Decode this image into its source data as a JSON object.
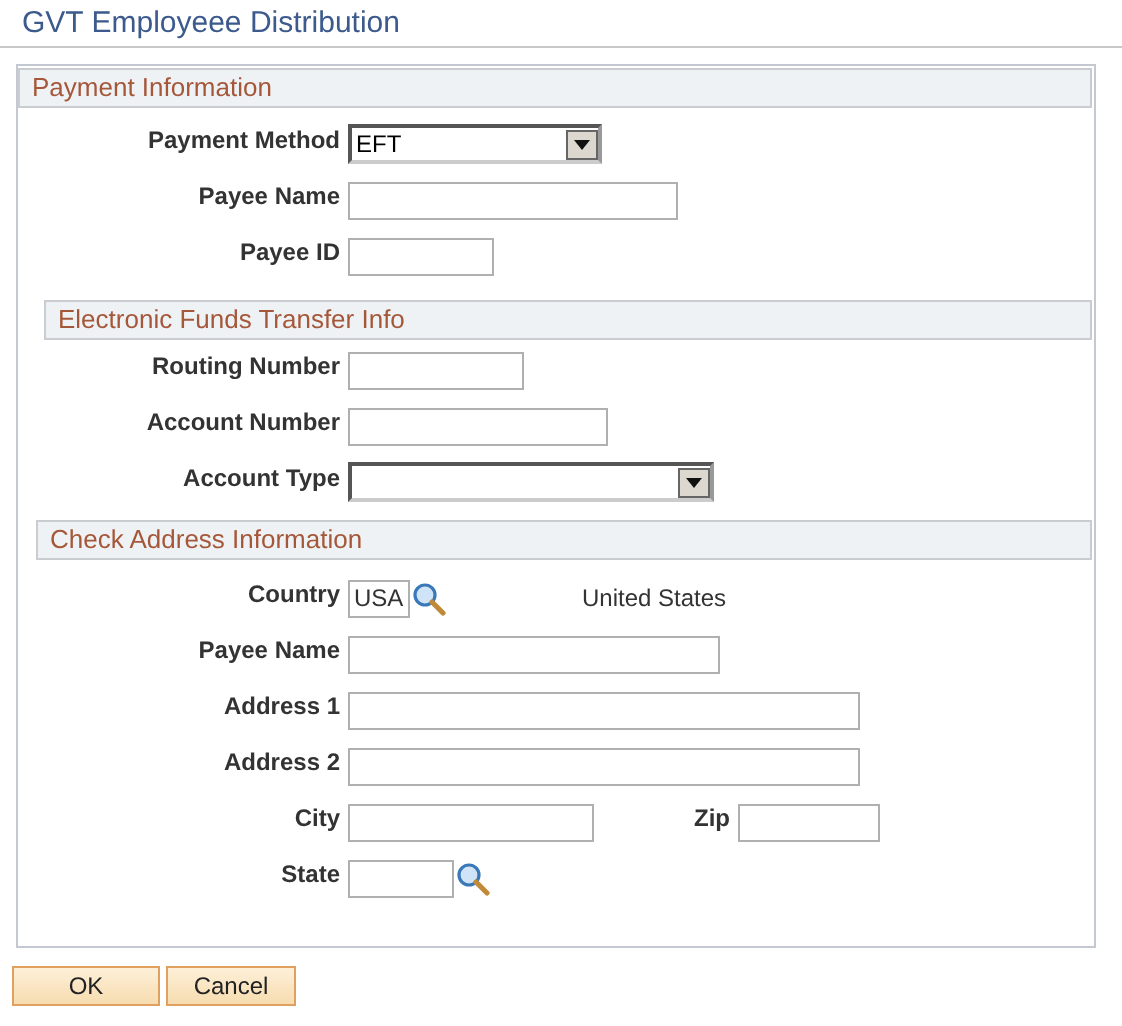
{
  "page_title": "GVT Employeee Distribution",
  "sections": [
    {
      "title": "Payment Information",
      "rows": [
        {
          "fields": [
            {
              "label": "Payment Method",
              "kind": "select",
              "value": "EFT"
            }
          ]
        },
        {
          "fields": [
            {
              "label": "Payee Name",
              "kind": "text"
            }
          ]
        },
        {
          "fields": [
            {
              "label": "Payee ID",
              "kind": "text"
            }
          ]
        }
      ]
    },
    {
      "title": "Electronic Funds Transfer Info",
      "rows": [
        {
          "fields": [
            {
              "label": "Routing Number",
              "kind": "text"
            }
          ]
        },
        {
          "fields": [
            {
              "label": "Account Number",
              "kind": "text"
            }
          ]
        },
        {
          "fields": [
            {
              "label": "Account Type",
              "kind": "select"
            }
          ]
        }
      ]
    },
    {
      "title": "Check Address Information",
      "rows": [
        {
          "fields": [
            {
              "label": "Country",
              "kind": "lookup",
              "value": "USA",
              "description": "United States"
            }
          ]
        },
        {
          "fields": [
            {
              "label": "Payee Name",
              "kind": "text"
            }
          ]
        },
        {
          "fields": [
            {
              "label": "Address 1",
              "kind": "text"
            }
          ]
        },
        {
          "fields": [
            {
              "label": "Address 2",
              "kind": "text"
            }
          ]
        },
        {
          "fields": [
            {
              "label": "City",
              "kind": "text"
            },
            {
              "label": "Zip",
              "kind": "text"
            }
          ]
        },
        {
          "fields": [
            {
              "label": "State",
              "kind": "lookup"
            }
          ]
        }
      ]
    }
  ],
  "buttons": [
    "OK",
    "Cancel"
  ]
}
